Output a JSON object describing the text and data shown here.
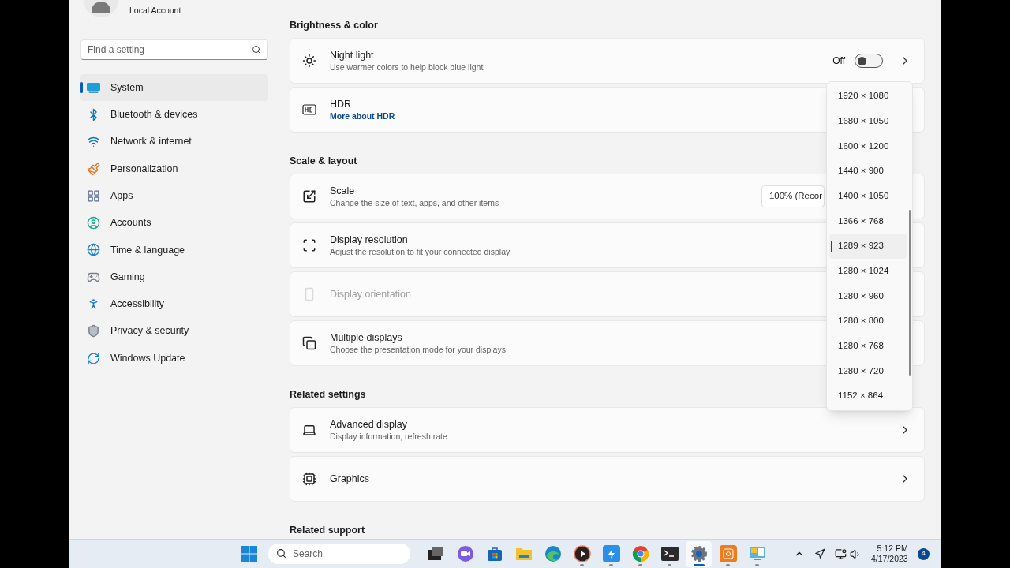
{
  "account": {
    "type": "Local Account"
  },
  "search": {
    "placeholder": "Find a setting"
  },
  "nav": [
    {
      "label": "System",
      "selected": true
    },
    {
      "label": "Bluetooth & devices",
      "selected": false
    },
    {
      "label": "Network & internet",
      "selected": false
    },
    {
      "label": "Personalization",
      "selected": false
    },
    {
      "label": "Apps",
      "selected": false
    },
    {
      "label": "Accounts",
      "selected": false
    },
    {
      "label": "Time & language",
      "selected": false
    },
    {
      "label": "Gaming",
      "selected": false
    },
    {
      "label": "Accessibility",
      "selected": false
    },
    {
      "label": "Privacy & security",
      "selected": false
    },
    {
      "label": "Windows Update",
      "selected": false
    }
  ],
  "sections": [
    {
      "title": "Brightness & color",
      "rows": [
        {
          "kind": "toggle",
          "title": "Night light",
          "subtitle": "Use warmer colors to help block blue light",
          "state_label": "Off",
          "on": false,
          "disabled": false
        },
        {
          "kind": "link",
          "title": "HDR",
          "link": "More about HDR",
          "disabled": false
        }
      ]
    },
    {
      "title": "Scale & layout",
      "rows": [
        {
          "kind": "select",
          "title": "Scale",
          "subtitle": "Change the size of text, apps, and other items",
          "value": "100% (Recor",
          "disabled": false
        },
        {
          "kind": "plain",
          "title": "Display resolution",
          "subtitle": "Adjust the resolution to fit your connected display",
          "disabled": false
        },
        {
          "kind": "plain",
          "title": "Display orientation",
          "disabled": true
        },
        {
          "kind": "plain",
          "title": "Multiple displays",
          "subtitle": "Choose the presentation mode for your displays",
          "disabled": false
        }
      ]
    },
    {
      "title": "Related settings",
      "rows": [
        {
          "kind": "nav",
          "title": "Advanced display",
          "subtitle": "Display information, refresh rate",
          "disabled": false
        },
        {
          "kind": "nav",
          "title": "Graphics",
          "disabled": false
        }
      ]
    },
    {
      "title": "Related support"
    }
  ],
  "resolution_menu": {
    "options": [
      {
        "label": "1920 × 1080",
        "selected": false
      },
      {
        "label": "1680 × 1050",
        "selected": false
      },
      {
        "label": "1600 × 1200",
        "selected": false
      },
      {
        "label": "1440 × 900",
        "selected": false
      },
      {
        "label": "1400 × 1050",
        "selected": false
      },
      {
        "label": "1366 × 768",
        "selected": false
      },
      {
        "label": "1289 × 923",
        "selected": true
      },
      {
        "label": "1280 × 1024",
        "selected": false
      },
      {
        "label": "1280 × 960",
        "selected": false
      },
      {
        "label": "1280 × 800",
        "selected": false
      },
      {
        "label": "1280 × 768",
        "selected": false
      },
      {
        "label": "1280 × 720",
        "selected": false
      },
      {
        "label": "1152 × 864",
        "selected": false
      }
    ]
  },
  "taskbar": {
    "search_placeholder": "Search",
    "apps": [
      {
        "selected": false,
        "running": false
      },
      {
        "selected": false,
        "running": false
      },
      {
        "selected": false,
        "running": false
      },
      {
        "selected": false,
        "running": false
      },
      {
        "selected": false,
        "running": false
      },
      {
        "selected": false,
        "running": true
      },
      {
        "selected": false,
        "running": true
      },
      {
        "selected": false,
        "running": true
      },
      {
        "selected": false,
        "running": true
      },
      {
        "selected": true,
        "running": true
      },
      {
        "selected": false,
        "running": true
      },
      {
        "selected": false,
        "running": true
      }
    ],
    "time": "5:12 PM",
    "date": "4/17/2023",
    "notifications": "4"
  }
}
